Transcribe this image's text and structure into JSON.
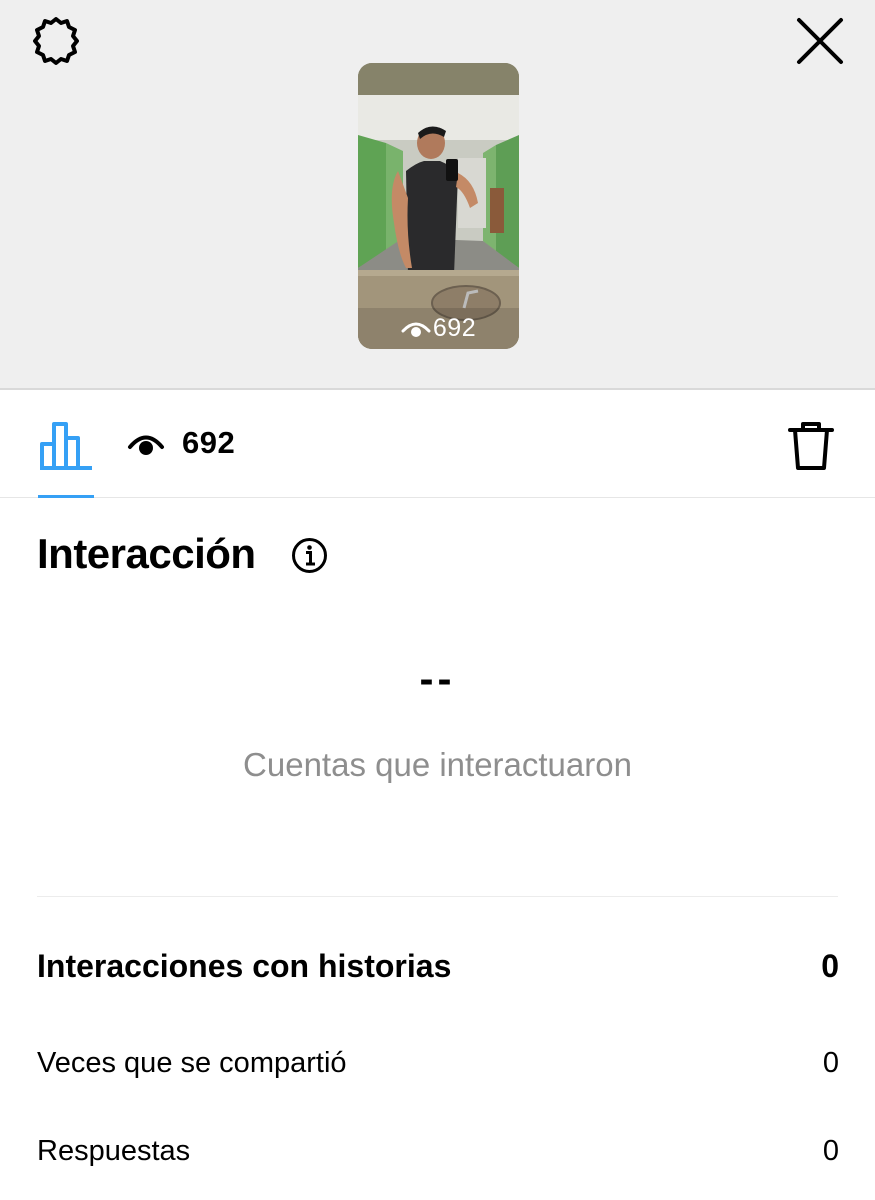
{
  "header": {
    "settings_icon": "gear-icon",
    "close_icon": "close-icon"
  },
  "story": {
    "views": "692"
  },
  "tabs": {
    "insights_icon": "bar-chart-icon",
    "insights_color": "#35a0f5",
    "views_icon": "eye-icon",
    "views_count": "692",
    "delete_icon": "trash-icon"
  },
  "interaction": {
    "title": "Interacción",
    "info_icon": "info-icon",
    "accounts_value": "--",
    "accounts_label": "Cuentas que interactuaron"
  },
  "story_interactions": {
    "title": "Interacciones con historias",
    "total": "0",
    "rows": [
      {
        "label": "Veces que se compartió",
        "value": "0"
      },
      {
        "label": "Respuestas",
        "value": "0"
      }
    ]
  }
}
